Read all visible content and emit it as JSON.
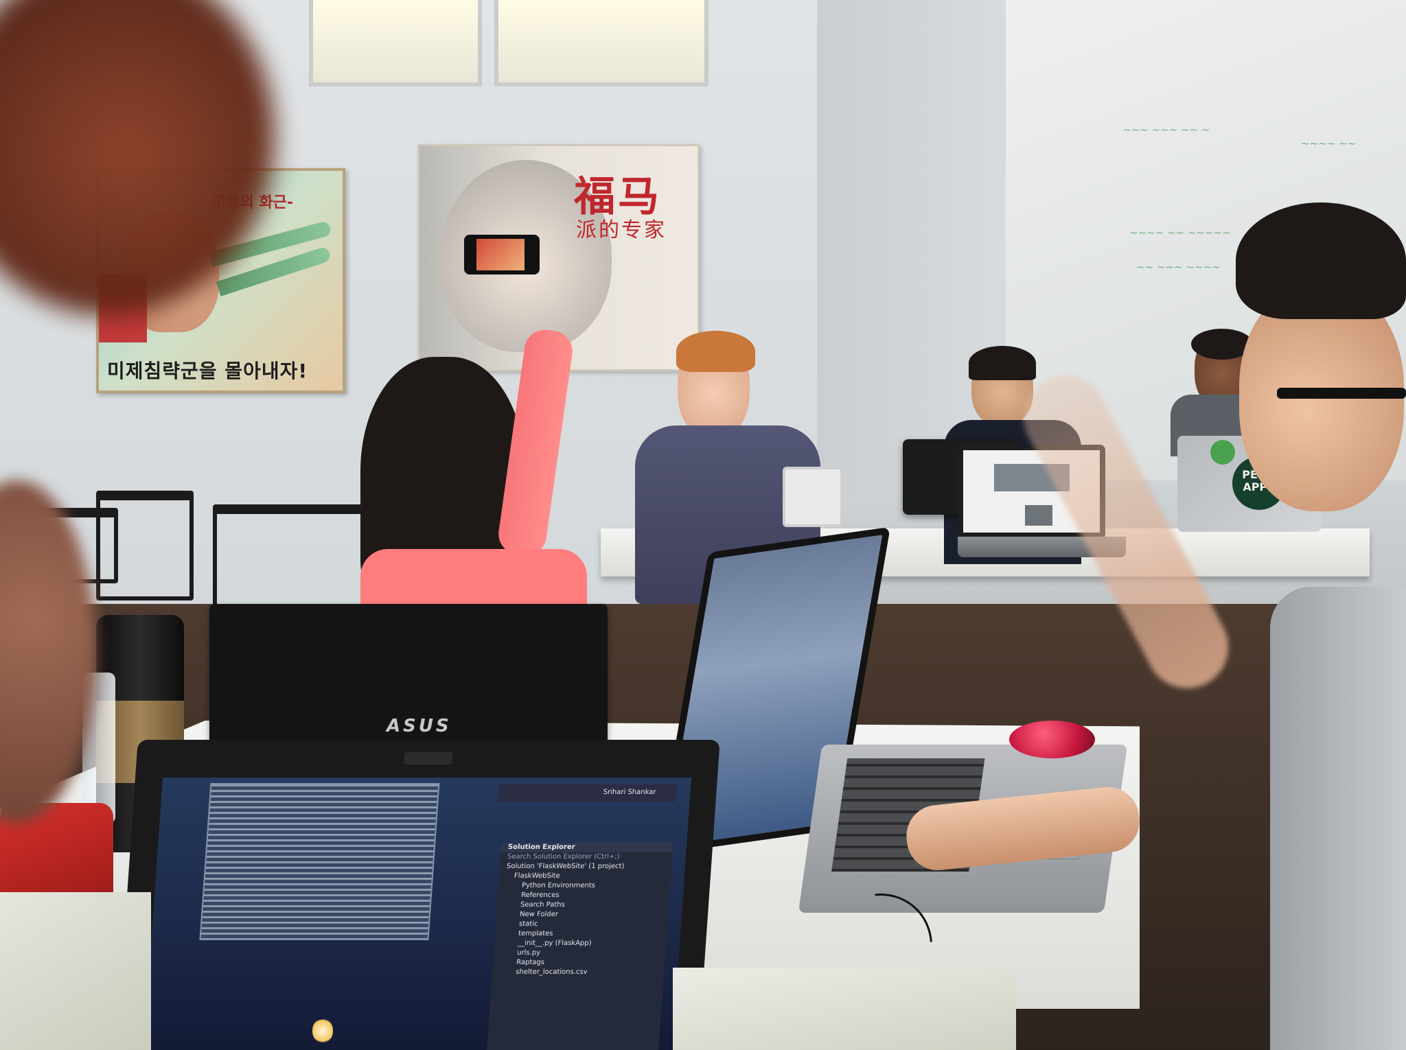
{
  "poster_korean": {
    "top_text": "고용의 화근-",
    "bottom_text": "미제침략군을 몰아내자!"
  },
  "poster_chinese": {
    "headline": "福马",
    "subline": "派的专家"
  },
  "laptop_brand": "ASUS",
  "front_laptop": {
    "title_user": "Srihari Shankar",
    "solution_explorer": {
      "title": "Solution Explorer",
      "search_placeholder": "Search Solution Explorer (Ctrl+;)",
      "items": [
        "Solution 'FlaskWebSite' (1 project)",
        "FlaskWebSite",
        "Python Environments",
        "References",
        "Search Paths",
        "New Folder",
        "static",
        "templates",
        "__init__.py (FlaskApp)",
        "urls.py",
        "Raptags",
        "shelter_locations.csv"
      ]
    }
  },
  "sticker_text": "PENN APPS",
  "colors": {
    "poster_red": "#c0272d",
    "mouse_red": "#c6163c",
    "whiteboard_marker": "#4b9b62"
  }
}
